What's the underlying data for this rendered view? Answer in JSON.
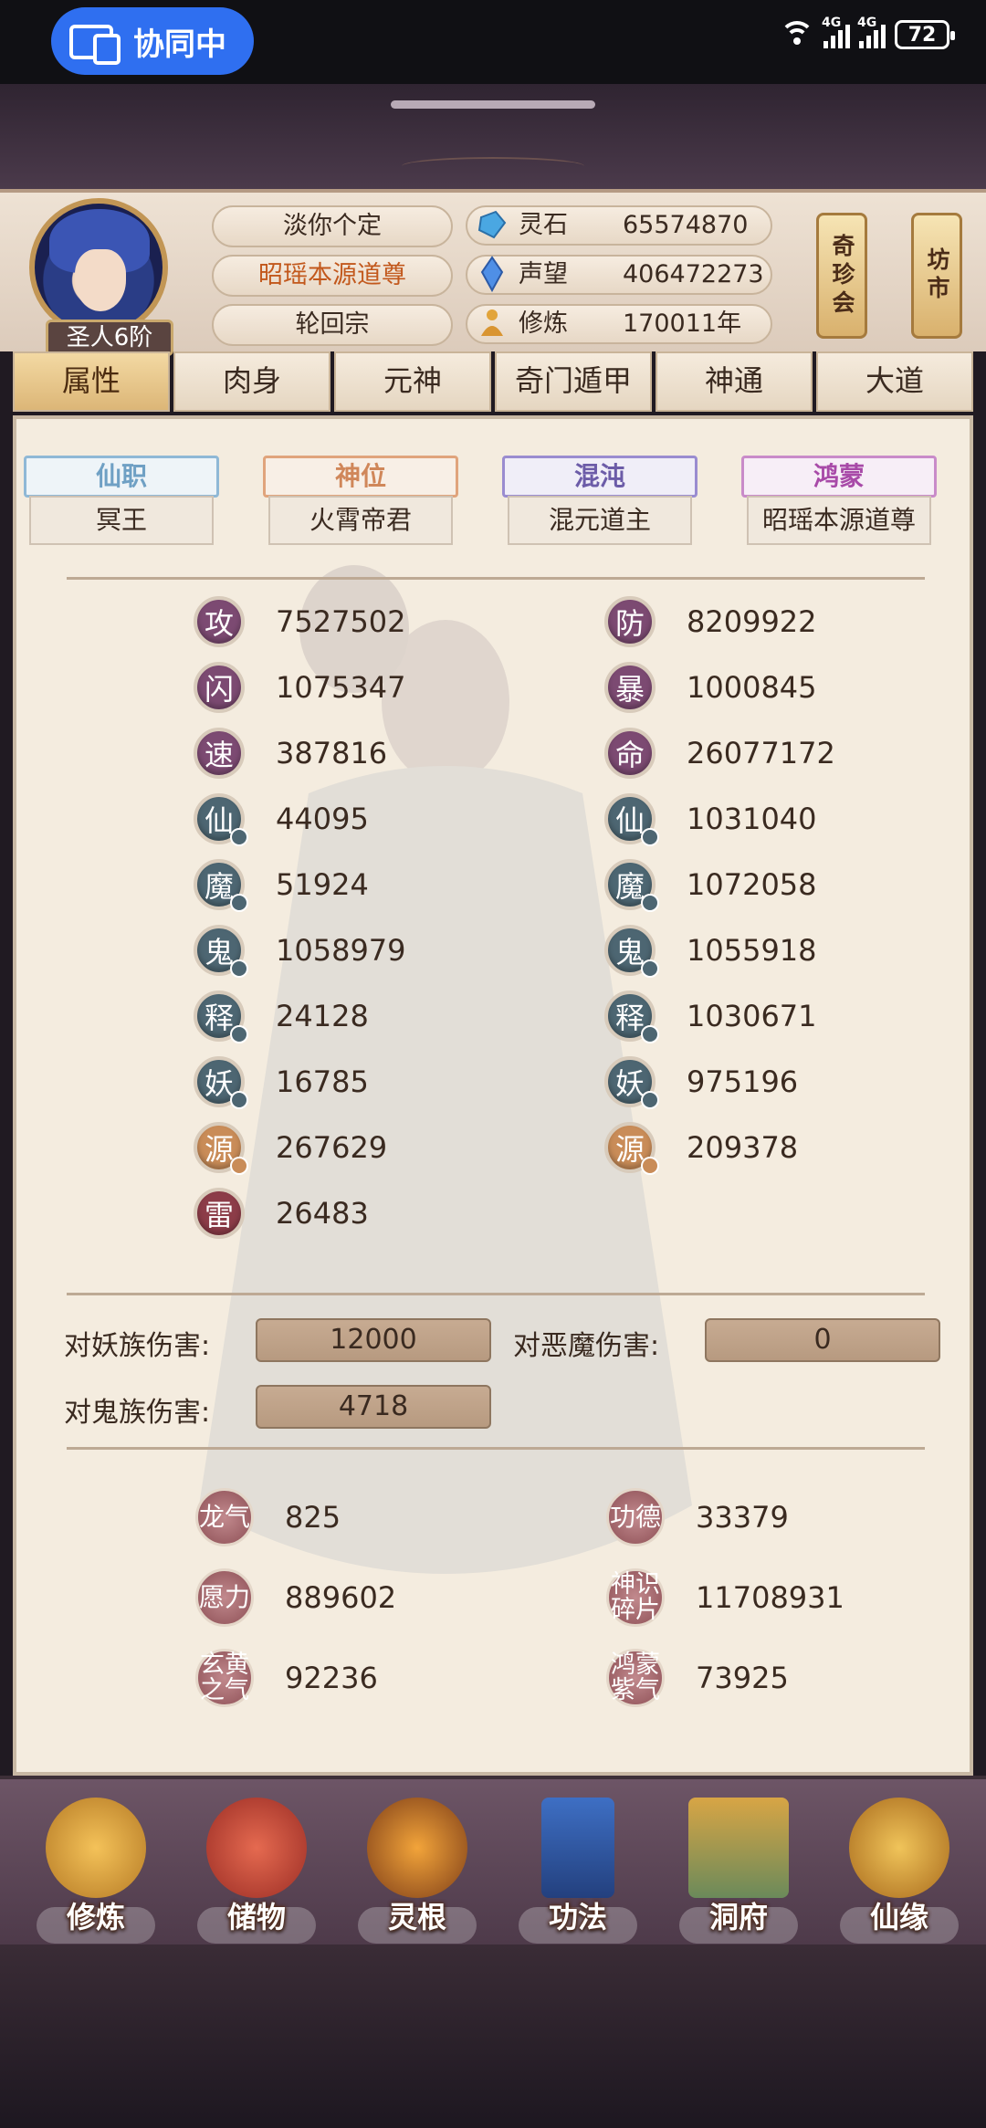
{
  "status_bar": {
    "collab_label": "协同中",
    "network_1": "4G",
    "network_2": "4G",
    "battery": "72"
  },
  "header": {
    "rank": "圣人6阶",
    "name": "淡你个定",
    "title": "昭瑶本源道尊",
    "sect": "轮回宗",
    "resources": [
      {
        "label": "灵石",
        "value": "65574870",
        "icon": "spirit-stone-icon"
      },
      {
        "label": "声望",
        "value": "406472273",
        "icon": "prestige-crystal-icon"
      },
      {
        "label": "修炼",
        "value": "170011年",
        "icon": "meditation-icon"
      }
    ],
    "side_buttons": [
      {
        "label": "奇珍会"
      },
      {
        "label": "坊市"
      }
    ]
  },
  "tabs": [
    {
      "label": "属性",
      "active": true
    },
    {
      "label": "肉身"
    },
    {
      "label": "元神"
    },
    {
      "label": "奇门遁甲"
    },
    {
      "label": "神通"
    },
    {
      "label": "大道"
    }
  ],
  "title_tabs": [
    {
      "label": "仙职",
      "value": "冥王",
      "color": "#6fa0c4"
    },
    {
      "label": "神位",
      "value": "火霄帝君",
      "color": "#d0875a"
    },
    {
      "label": "混沌",
      "value": "混元道主",
      "color": "#6c5ca8"
    },
    {
      "label": "鸿蒙",
      "value": "昭瑶本源道尊",
      "color": "#a84aa8"
    }
  ],
  "stats_left": [
    {
      "glyph": "攻",
      "value": "7527502",
      "color": "#7c4a72"
    },
    {
      "glyph": "闪",
      "value": "1075347",
      "color": "#7c4a72"
    },
    {
      "glyph": "速",
      "value": "387816",
      "color": "#7c4a72"
    },
    {
      "glyph": "仙",
      "value": "44095",
      "color": "#4d6672"
    },
    {
      "glyph": "魔",
      "value": "51924",
      "color": "#4d6672"
    },
    {
      "glyph": "鬼",
      "value": "1058979",
      "color": "#4d6672"
    },
    {
      "glyph": "释",
      "value": "24128",
      "color": "#4d6672"
    },
    {
      "glyph": "妖",
      "value": "16785",
      "color": "#4d6672"
    },
    {
      "glyph": "源",
      "value": "267629",
      "color": "#c98c58"
    },
    {
      "glyph": "雷",
      "value": "26483",
      "color": "#8c3c48"
    }
  ],
  "stats_right": [
    {
      "glyph": "防",
      "value": "8209922",
      "color": "#7c4a72"
    },
    {
      "glyph": "暴",
      "value": "1000845",
      "color": "#7c4a72"
    },
    {
      "glyph": "命",
      "value": "26077172",
      "color": "#7c4a72"
    },
    {
      "glyph": "仙",
      "value": "1031040",
      "color": "#4d6672"
    },
    {
      "glyph": "魔",
      "value": "1072058",
      "color": "#4d6672"
    },
    {
      "glyph": "鬼",
      "value": "1055918",
      "color": "#4d6672"
    },
    {
      "glyph": "释",
      "value": "1030671",
      "color": "#4d6672"
    },
    {
      "glyph": "妖",
      "value": "975196",
      "color": "#4d6672"
    },
    {
      "glyph": "源",
      "value": "209378",
      "color": "#c98c58"
    }
  ],
  "damage": [
    {
      "label": "对妖族伤害:",
      "value": "12000"
    },
    {
      "label": "对恶魔伤害:",
      "value": "0"
    },
    {
      "label": "对鬼族伤害:",
      "value": "4718"
    }
  ],
  "extras": [
    {
      "glyph": "龙气",
      "value": "825"
    },
    {
      "glyph": "功德",
      "value": "33379"
    },
    {
      "glyph": "愿力",
      "value": "889602"
    },
    {
      "glyph": "神识碎片",
      "value": "11708931"
    },
    {
      "glyph": "玄黄之气",
      "value": "92236"
    },
    {
      "glyph": "鸿蒙紫气",
      "value": "73925"
    }
  ],
  "bottom_nav": [
    {
      "label": "修炼",
      "icon": "cultivation-monk-icon"
    },
    {
      "label": "储物",
      "icon": "storage-bag-icon"
    },
    {
      "label": "灵根",
      "icon": "spirit-root-icon"
    },
    {
      "label": "功法",
      "icon": "technique-book-icon"
    },
    {
      "label": "洞府",
      "icon": "cave-dwelling-icon"
    },
    {
      "label": "仙缘",
      "icon": "immortal-fate-gourd-icon"
    }
  ]
}
